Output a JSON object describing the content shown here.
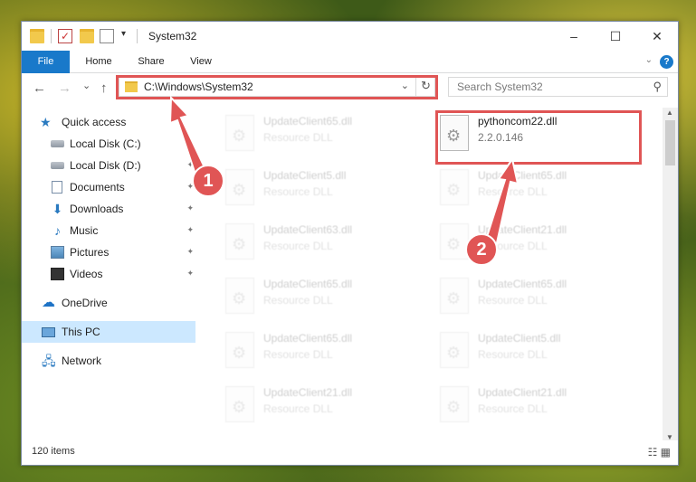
{
  "window": {
    "title": "System32",
    "controls": {
      "minimize": "–",
      "maximize": "☐",
      "close": "✕"
    }
  },
  "quick_access_toolbar": {
    "dropdown": "▾"
  },
  "ribbon": {
    "tabs": [
      "File",
      "Home",
      "Share",
      "View"
    ],
    "chevron": "⌄",
    "help": "?"
  },
  "nav": {
    "back": "←",
    "forward": "→",
    "recent": "⌄",
    "up": "↑"
  },
  "address_bar": {
    "path": "C:\\Windows\\System32",
    "dropdown": "⌄",
    "refresh": "↻"
  },
  "search": {
    "placeholder": "Search System32",
    "icon": "⚲"
  },
  "sidebar": {
    "items": [
      {
        "label": "Quick access",
        "icon": "star-icon"
      },
      {
        "label": "Local Disk (C:)",
        "icon": "disk-icon",
        "pinned": true
      },
      {
        "label": "Local Disk (D:)",
        "icon": "disk-icon",
        "pinned": true
      },
      {
        "label": "Documents",
        "icon": "document-icon",
        "pinned": true
      },
      {
        "label": "Downloads",
        "icon": "download-icon",
        "pinned": true
      },
      {
        "label": "Music",
        "icon": "music-icon",
        "pinned": true
      },
      {
        "label": "Pictures",
        "icon": "picture-icon",
        "pinned": true
      },
      {
        "label": "Videos",
        "icon": "video-icon",
        "pinned": true
      },
      {
        "label": "OneDrive",
        "icon": "cloud-icon"
      },
      {
        "label": "This PC",
        "icon": "pc-icon",
        "selected": true
      },
      {
        "label": "Network",
        "icon": "network-icon"
      }
    ],
    "pin_glyph": "📌"
  },
  "files": {
    "highlighted": {
      "name": "pythoncom22.dll",
      "detail": "2.2.0.146"
    },
    "left_column": [
      {
        "name": "UpdateClient65.dll",
        "detail": "Resource DLL"
      },
      {
        "name": "UpdateClient5.dll",
        "detail": "Resource DLL"
      },
      {
        "name": "UpdateClient63.dll",
        "detail": "Resource DLL"
      },
      {
        "name": "UpdateClient65.dll",
        "detail": "Resource DLL"
      },
      {
        "name": "UpdateClient65.dll",
        "detail": "Resource DLL"
      },
      {
        "name": "UpdateClient21.dll",
        "detail": "Resource DLL"
      }
    ],
    "right_column": [
      {
        "name": "UpdateClient65.dll",
        "detail": "Resource DLL"
      },
      {
        "name": "UpdateClient21.dll",
        "detail": "Resource DLL"
      },
      {
        "name": "UpdateClient65.dll",
        "detail": "Resource DLL"
      },
      {
        "name": "UpdateClient5.dll",
        "detail": "Resource DLL"
      },
      {
        "name": "UpdateClient21.dll",
        "detail": "Resource DLL"
      }
    ]
  },
  "status_bar": {
    "item_count": "120 items",
    "view_icons": "☷ ▦"
  },
  "annotations": {
    "step1": "1",
    "step2": "2",
    "color": "#e05555"
  },
  "scrollbar": {
    "up": "▲",
    "down": "▼"
  }
}
